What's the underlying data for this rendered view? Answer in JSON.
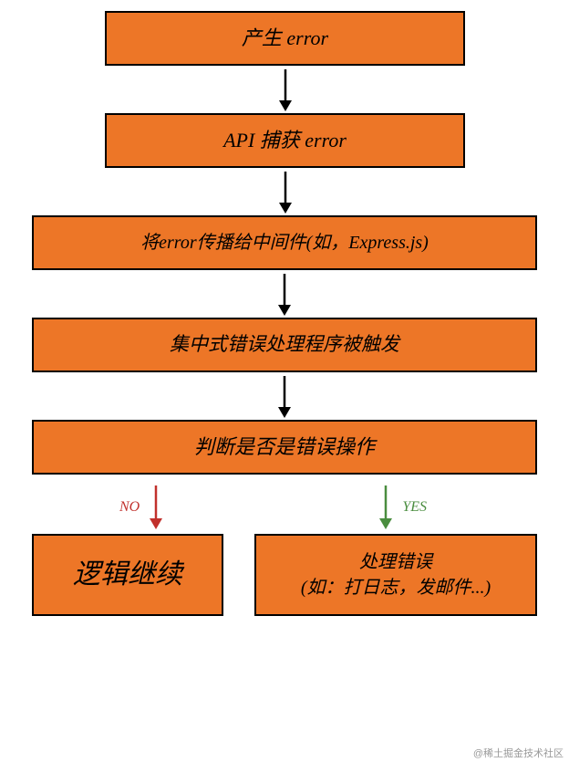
{
  "boxes": {
    "b1": "产生 error",
    "b2": "API 捕获 error",
    "b3": "将error传播给中间件(如，Express.js)",
    "b4": "集中式错误处理程序被触发",
    "b5": "判断是否是错误操作",
    "b6": "逻辑继续",
    "b7_line1": "处理错误",
    "b7_line2": "(如：打日志，发邮件...)"
  },
  "labels": {
    "no": "NO",
    "yes": "YES"
  },
  "colors": {
    "box_fill": "#ed7627",
    "arrow_black": "#000000",
    "arrow_red": "#c1302c",
    "arrow_green": "#4a8d3f"
  },
  "watermark": "@稀土掘金技术社区",
  "chart_data": {
    "type": "flowchart",
    "nodes": [
      {
        "id": "n1",
        "text": "产生 error"
      },
      {
        "id": "n2",
        "text": "API 捕获 error"
      },
      {
        "id": "n3",
        "text": "将error传播给中间件(如，Express.js)"
      },
      {
        "id": "n4",
        "text": "集中式错误处理程序被触发"
      },
      {
        "id": "n5",
        "text": "判断是否是错误操作",
        "decision": true
      },
      {
        "id": "n6",
        "text": "逻辑继续"
      },
      {
        "id": "n7",
        "text": "处理错误 (如：打日志，发邮件...)"
      }
    ],
    "edges": [
      {
        "from": "n1",
        "to": "n2"
      },
      {
        "from": "n2",
        "to": "n3"
      },
      {
        "from": "n3",
        "to": "n4"
      },
      {
        "from": "n4",
        "to": "n5"
      },
      {
        "from": "n5",
        "to": "n6",
        "label": "NO",
        "color": "#c1302c"
      },
      {
        "from": "n5",
        "to": "n7",
        "label": "YES",
        "color": "#4a8d3f"
      }
    ]
  }
}
